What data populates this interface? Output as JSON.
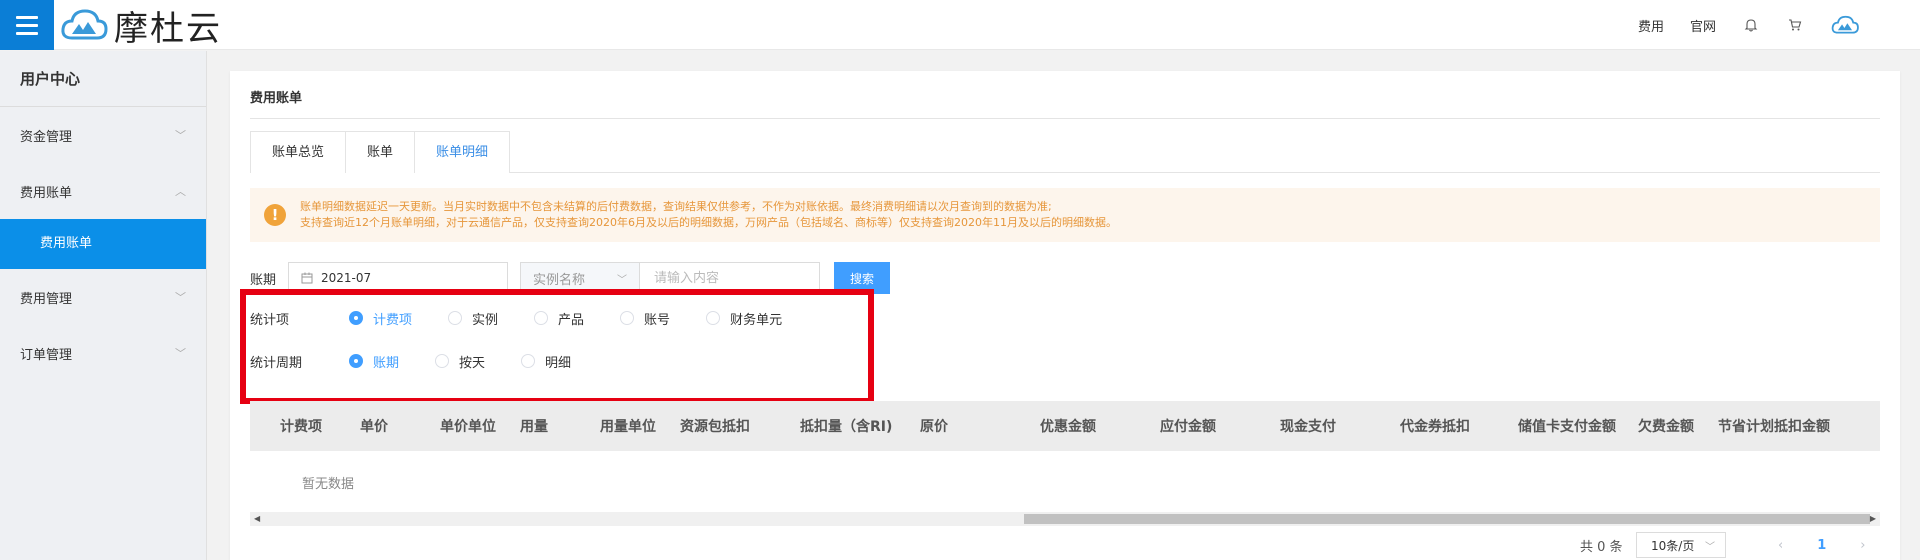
{
  "header": {
    "logo_text": "摩杜云",
    "links": [
      "费用",
      "官网"
    ],
    "icons": [
      "bell-icon",
      "cart-icon",
      "user-avatar-icon"
    ]
  },
  "sidebar": {
    "title": "用户中心",
    "items": [
      {
        "label": "资金管理",
        "expanded": false
      },
      {
        "label": "费用账单",
        "expanded": true,
        "sub": [
          "费用账单"
        ]
      },
      {
        "label": "费用管理",
        "expanded": false
      },
      {
        "label": "订单管理",
        "expanded": false
      }
    ]
  },
  "main": {
    "title": "费用账单",
    "tabs": [
      "账单总览",
      "账单",
      "账单明细"
    ],
    "active_tab": "账单明细",
    "notice": {
      "line1": "账单明细数据延迟一天更新。当月实时数据中不包含未结算的后付费数据，查询结果仅供参考，不作为对账依据。最终消费明细请以次月查询到的数据为准;",
      "line2": "支持查询近12个月账单明细，对于云通信产品，仅支持查询2020年6月及以后的明细数据，万网产品（包括域名、商标等）仅支持查询2020年11月及以后的明细数据。"
    },
    "filter": {
      "period_label": "账期",
      "period_value": "2021-07",
      "select_value": "实例名称",
      "input_placeholder": "请输入内容",
      "search_label": "搜索"
    },
    "stat_item": {
      "label": "统计项",
      "options": [
        "计费项",
        "实例",
        "产品",
        "账号",
        "财务单元"
      ],
      "selected": "计费项"
    },
    "stat_period": {
      "label": "统计周期",
      "options": [
        "账期",
        "按天",
        "明细"
      ],
      "selected": "账期"
    },
    "table": {
      "columns": [
        "计费项",
        "单价",
        "单价单位",
        "用量",
        "用量单位",
        "资源包抵扣",
        "抵扣量（含RI)",
        "原价",
        "优惠金额",
        "应付金额",
        "现金支付",
        "代金券抵扣",
        "储值卡支付金额",
        "欠费金额",
        "节省计划抵扣金额"
      ],
      "empty_text": "暂无数据"
    },
    "pagination": {
      "total_text": "共 0 条",
      "page_size": "10条/页",
      "current_page": "1"
    }
  },
  "colors": {
    "brand_blue": "#0b7ed6",
    "active_blue": "#409eff",
    "warning_orange": "#e6963a",
    "highlight_red": "#e60012"
  }
}
